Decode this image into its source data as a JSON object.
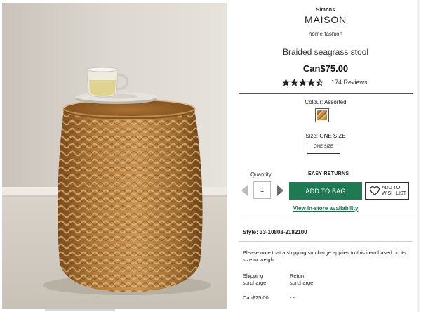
{
  "brand": {
    "small": "Simons",
    "big": "MAISON",
    "category": "home fashion"
  },
  "product": {
    "title": "Braided seagrass stool",
    "price": "Can$75.00",
    "rating": 4.5,
    "rating_max": 5,
    "reviews": "174 Reviews"
  },
  "colour": {
    "label": "Colour: Assorted",
    "swatch_color": "#b7823e"
  },
  "size": {
    "label": "Size: ONE SIZE",
    "option": "ONE SIZE"
  },
  "purchase": {
    "quantity_label": "Quantity",
    "quantity": "1",
    "easy_returns": "EASY RETURNS",
    "add_to_bag": "ADD TO BAG",
    "wishlist_line1": "ADD TO",
    "wishlist_line2": "WISH LIST",
    "instore": "View in-store availability"
  },
  "details": {
    "style": "Style: 33-10808-2182100",
    "surcharge_note": "Please note that a shipping surcharge applies to this item based on its size or weight.",
    "shipping_head_1": "Shipping",
    "shipping_head_2": "surcharge",
    "return_head_1": "Return",
    "return_head_2": "surcharge",
    "shipping_value": "Can$25.00",
    "return_value": "- -"
  },
  "colors": {
    "accent_green": "#1f7a54",
    "link_green": "#1a6b48",
    "star": "#222222"
  },
  "icons": {
    "star": "star-icon",
    "heart": "heart-icon",
    "prev": "chevron-left-icon",
    "next": "chevron-right-icon"
  }
}
